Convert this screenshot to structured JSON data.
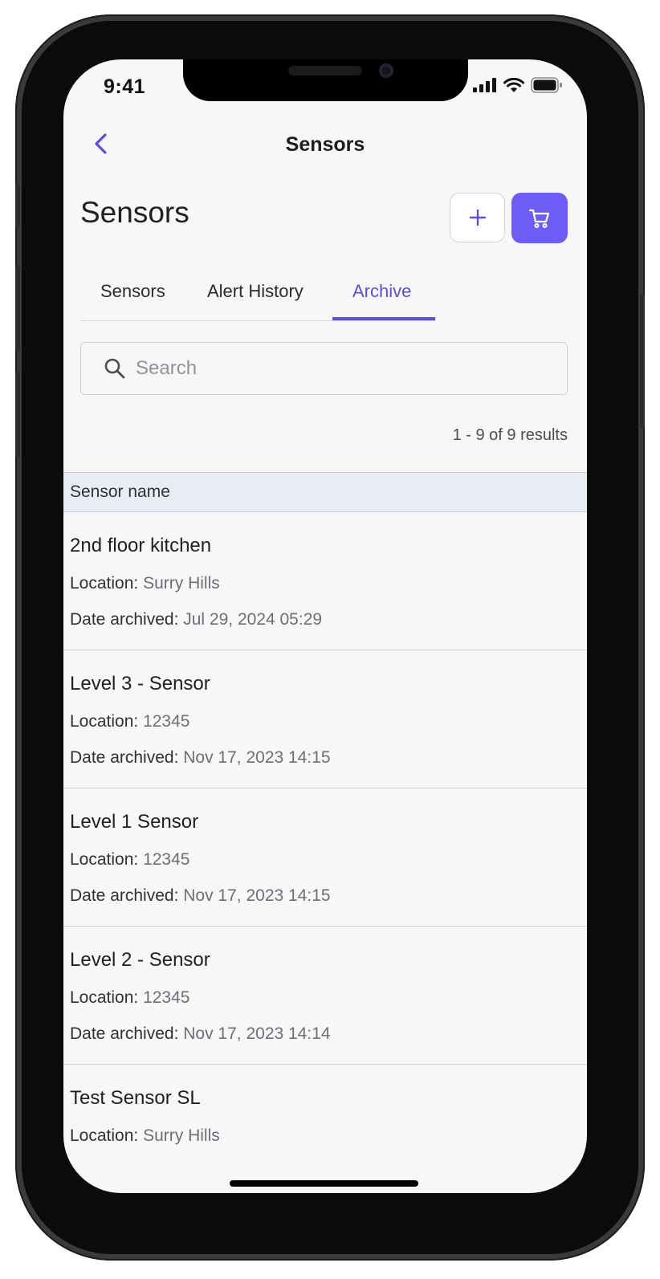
{
  "status_bar": {
    "time": "9:41"
  },
  "nav": {
    "title": "Sensors"
  },
  "page": {
    "title": "Sensors"
  },
  "tabs": [
    {
      "label": "Sensors",
      "active": false
    },
    {
      "label": "Alert History",
      "active": false
    },
    {
      "label": "Archive",
      "active": true
    }
  ],
  "search": {
    "placeholder": "Search",
    "value": ""
  },
  "results_text": "1 - 9 of 9 results",
  "table": {
    "column_header": "Sensor name",
    "location_label": "Location:",
    "date_label": "Date archived:",
    "rows": [
      {
        "name": "2nd floor kitchen",
        "location": "Surry Hills",
        "date_archived": "Jul 29, 2024 05:29"
      },
      {
        "name": "Level 3 - Sensor",
        "location": "12345",
        "date_archived": "Nov 17, 2023 14:15"
      },
      {
        "name": "Level 1 Sensor",
        "location": "12345",
        "date_archived": "Nov 17, 2023 14:15"
      },
      {
        "name": "Level 2 - Sensor",
        "location": "12345",
        "date_archived": "Nov 17, 2023 14:14"
      },
      {
        "name": "Test Sensor SL",
        "location": "Surry Hills",
        "date_archived": ""
      }
    ]
  },
  "colors": {
    "accent": "#6d5cf5",
    "tab_active": "#5a4fd6",
    "header_bg": "#e9ecf5"
  },
  "icons": {
    "back": "chevron-left-icon",
    "add": "plus-icon",
    "cart": "cart-icon",
    "search": "search-icon"
  }
}
